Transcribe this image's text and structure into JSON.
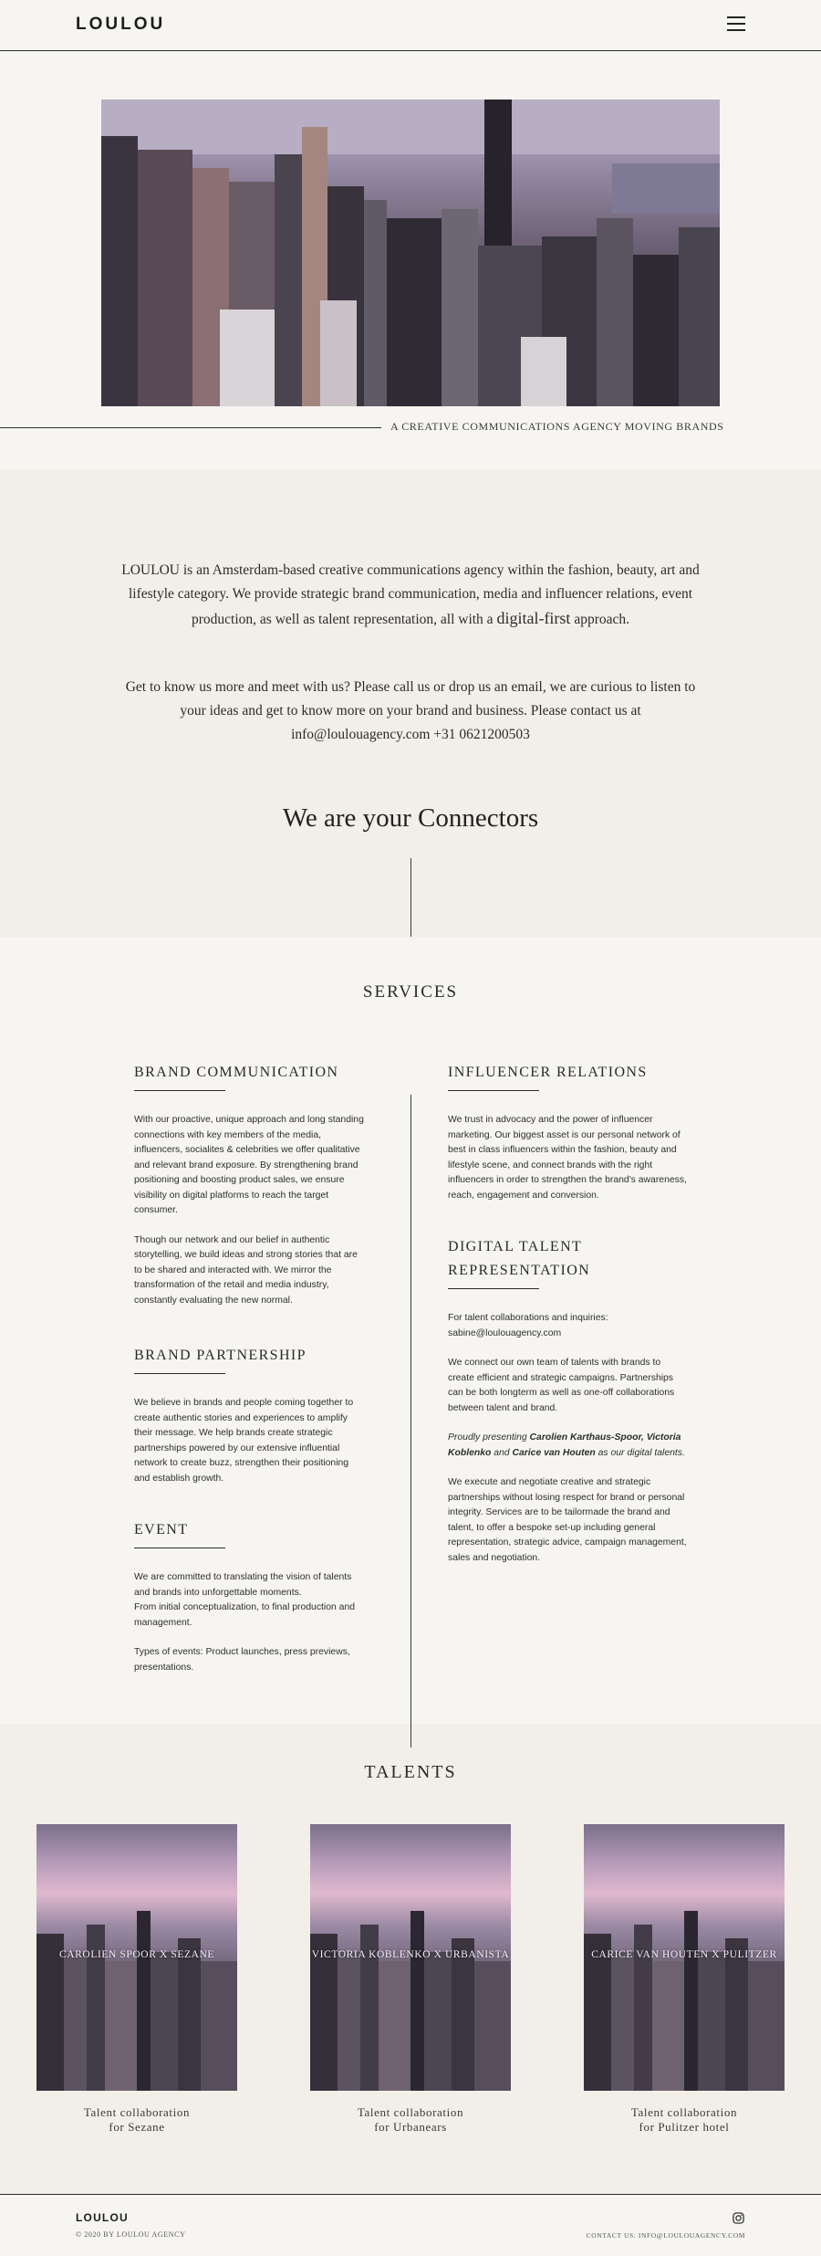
{
  "header": {
    "logo": "LOULOU",
    "menu_icon": "hamburger-menu-icon"
  },
  "hero": {
    "tagline": "A CREATIVE COMMUNICATIONS AGENCY MOVING BRANDS"
  },
  "intro": {
    "p1_before": "LOULOU is an Amsterdam-based creative communications agency within the fashion, beauty, art and lifestyle category. We provide strategic brand communication, media and influencer relations, event production, as well as talent representation, all with a ",
    "p1_emphasis": "digital-first",
    "p1_after": " approach.",
    "p2": "Get to know us more and meet with us? Please call us or drop us an email, we are curious to listen to your ideas and get to know more on your brand and business. Please contact us at info@loulouagency.com +31 0621200503",
    "connectors": "We are your Connectors"
  },
  "services": {
    "title": "SERVICES",
    "brand_communication": {
      "title": "BRAND COMMUNICATION",
      "p1": "With our proactive, unique approach and long standing connections with key members of the media, influencers, socialites & celebrities we offer qualitative and relevant brand exposure. By strengthening brand positioning and boosting product sales, we ensure visibility on digital platforms to reach the target consumer.",
      "p2": "Though our network and our belief in authentic storytelling, we build ideas and strong stories that are to be shared and interacted with. We mirror the transformation of the retail and media industry, constantly evaluating the new normal."
    },
    "brand_partnership": {
      "title": "BRAND PARTNERSHIP",
      "p1": "We believe in brands and people coming together to create authentic stories and experiences to amplify their message. We help brands create strategic partnerships powered by our extensive influential network to create buzz, strengthen their positioning and establish growth."
    },
    "event": {
      "title": "EVENT",
      "p1": "We are committed to translating the vision of talents and brands into unforgettable moments.",
      "p1b": "From initial conceptualization, to final production and management.",
      "p2": "Types of events: Product launches, press previews, presentations."
    },
    "influencer_relations": {
      "title": "INFLUENCER RELATIONS",
      "p1": "We trust in advocacy and the power of influencer marketing. Our biggest asset is our personal network of best in class influencers within the fashion, beauty and lifestyle scene, and connect brands with the right influencers in order to strengthen the brand's awareness, reach, engagement and conversion."
    },
    "digital_talent": {
      "title_line1": "DIGITAL TALENT",
      "title_line2": "REPRESENTATION",
      "p1": "For talent collaborations and inquiries: sabine@loulouagency.com",
      "p2": "We connect our own team of talents with brands to create efficient and strategic campaigns. Partnerships can be both longterm as well as one-off collaborations between talent and brand.",
      "p3_a": "Proudly presenting ",
      "p3_name1": "Carolien Karthaus-Spoor, Victoria Koblenko",
      "p3_b": " and ",
      "p3_name2": "Carice van Houten",
      "p3_c": " as our digital talents.",
      "p4": "We execute and negotiate creative and strategic partnerships without losing respect for brand or personal integrity. Services are to be tailormade the brand and talent, to offer a bespoke set-up including general representation, strategic advice, campaign management, sales and negotiation."
    }
  },
  "talents": {
    "title": "TALENTS",
    "cards": [
      {
        "name": "CAROLIEN SPOOR X SEZANE",
        "caption1": "Talent collaboration",
        "caption2": "for Sezane"
      },
      {
        "name": "VICTORIA KOBLENKO X URBANISTA",
        "caption1": "Talent collaboration",
        "caption2": "for Urbanears"
      },
      {
        "name": "CARICE VAN HOUTEN X PULITZER",
        "caption1": "Talent collaboration",
        "caption2": "for Pulitzer hotel"
      }
    ]
  },
  "footer": {
    "logo": "LOULOU",
    "copyright": "© 2020 BY LOULOU AGENCY",
    "contact": "CONTACT US: INFO@LOULOUAGENCY.COM",
    "social_icon": "instagram-icon"
  }
}
